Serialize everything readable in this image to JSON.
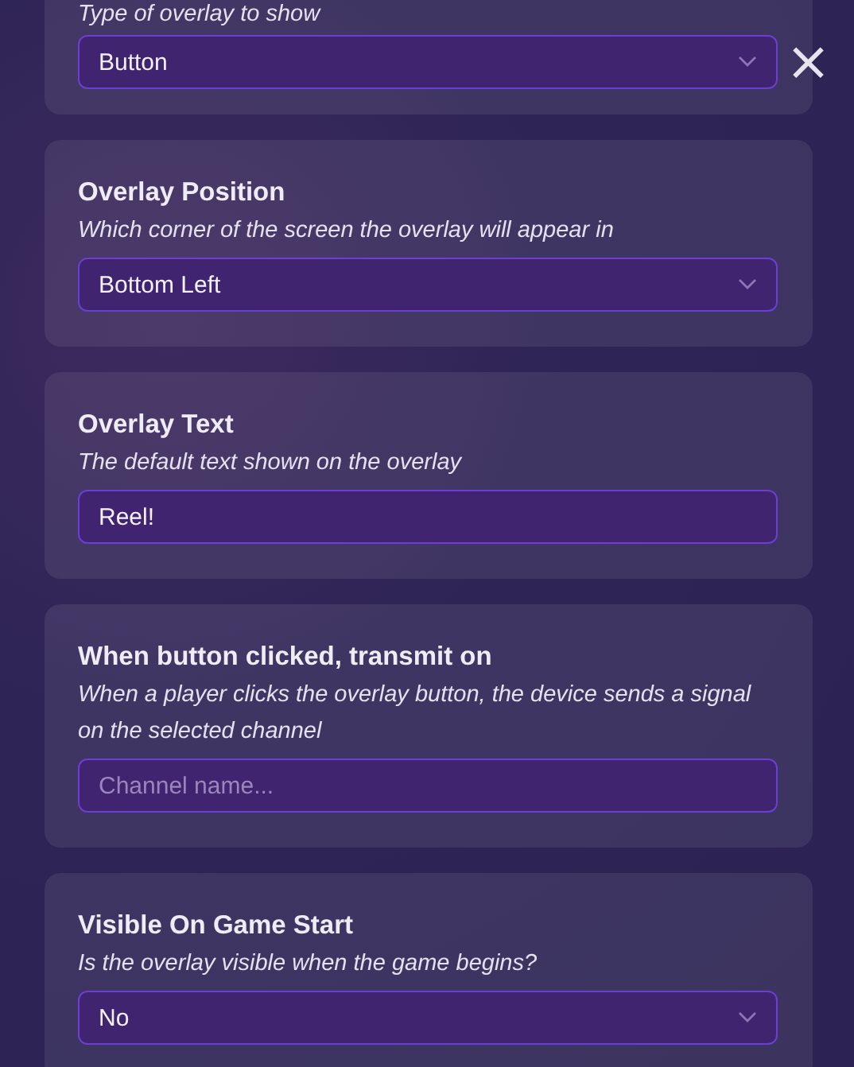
{
  "close_button": {
    "label": "×"
  },
  "settings": [
    {
      "kind": "select",
      "description": "Type of overlay to show",
      "value": "Button"
    },
    {
      "kind": "select",
      "title": "Overlay Position",
      "description": "Which corner of the screen the overlay will appear in",
      "value": "Bottom Left"
    },
    {
      "kind": "text",
      "title": "Overlay Text",
      "description": "The default text shown on the overlay",
      "value": "Reel!"
    },
    {
      "kind": "text",
      "title": "When button clicked, transmit on",
      "description": "When a player clicks the overlay button, the device sends a signal on the selected channel",
      "placeholder": "Channel name..."
    },
    {
      "kind": "select",
      "title": "Visible On Game Start",
      "description": "Is the overlay visible when the game begins?",
      "value": "No"
    }
  ]
}
